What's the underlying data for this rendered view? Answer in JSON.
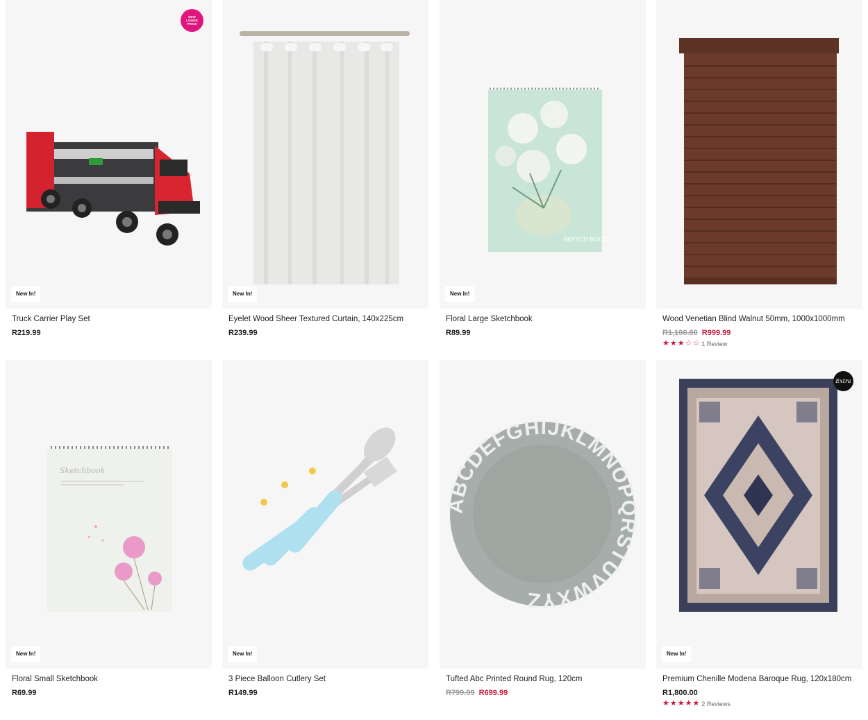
{
  "products": [
    {
      "title": "Truck Carrier Play Set",
      "price": "R219.99",
      "badge": "New In!",
      "promo": "NEW LOWER PRICE"
    },
    {
      "title": "Eyelet Wood Sheer Textured Curtain, 140x225cm",
      "price": "R239.99",
      "badge": "New In!"
    },
    {
      "title": "Floral Large Sketchbook",
      "price": "R89.99",
      "badge": "New In!",
      "image_text": "SKETCH BOOK"
    },
    {
      "title": "Wood Venetian Blind Walnut 50mm, 1000x1000mm",
      "old_price": "R1,100.00",
      "price": "R999.99",
      "rating": 3,
      "reviews": "1 Review"
    },
    {
      "title": "Floral Small Sketchbook",
      "price": "R69.99",
      "badge": "New In!",
      "image_text": "Sketchbook"
    },
    {
      "title": "3 Piece Balloon Cutlery Set",
      "price": "R149.99",
      "badge": "New In!"
    },
    {
      "title": "Tufted Abc Printed Round Rug, 120cm",
      "old_price": "R799.99",
      "price": "R699.99",
      "image_text": "ABCDEFGHIJKLMNOPQRSTUVWXYZ"
    },
    {
      "title": "Premium Chenille Modena Baroque Rug, 120x180cm",
      "price": "R1,800.00",
      "badge": "New In!",
      "promo": "Extra",
      "rating": 5,
      "reviews": "2 Reviews"
    }
  ],
  "colors": {
    "sale": "#c9183c",
    "promo_pink": "#e0167e",
    "image_bg": "#f6f6f6"
  }
}
